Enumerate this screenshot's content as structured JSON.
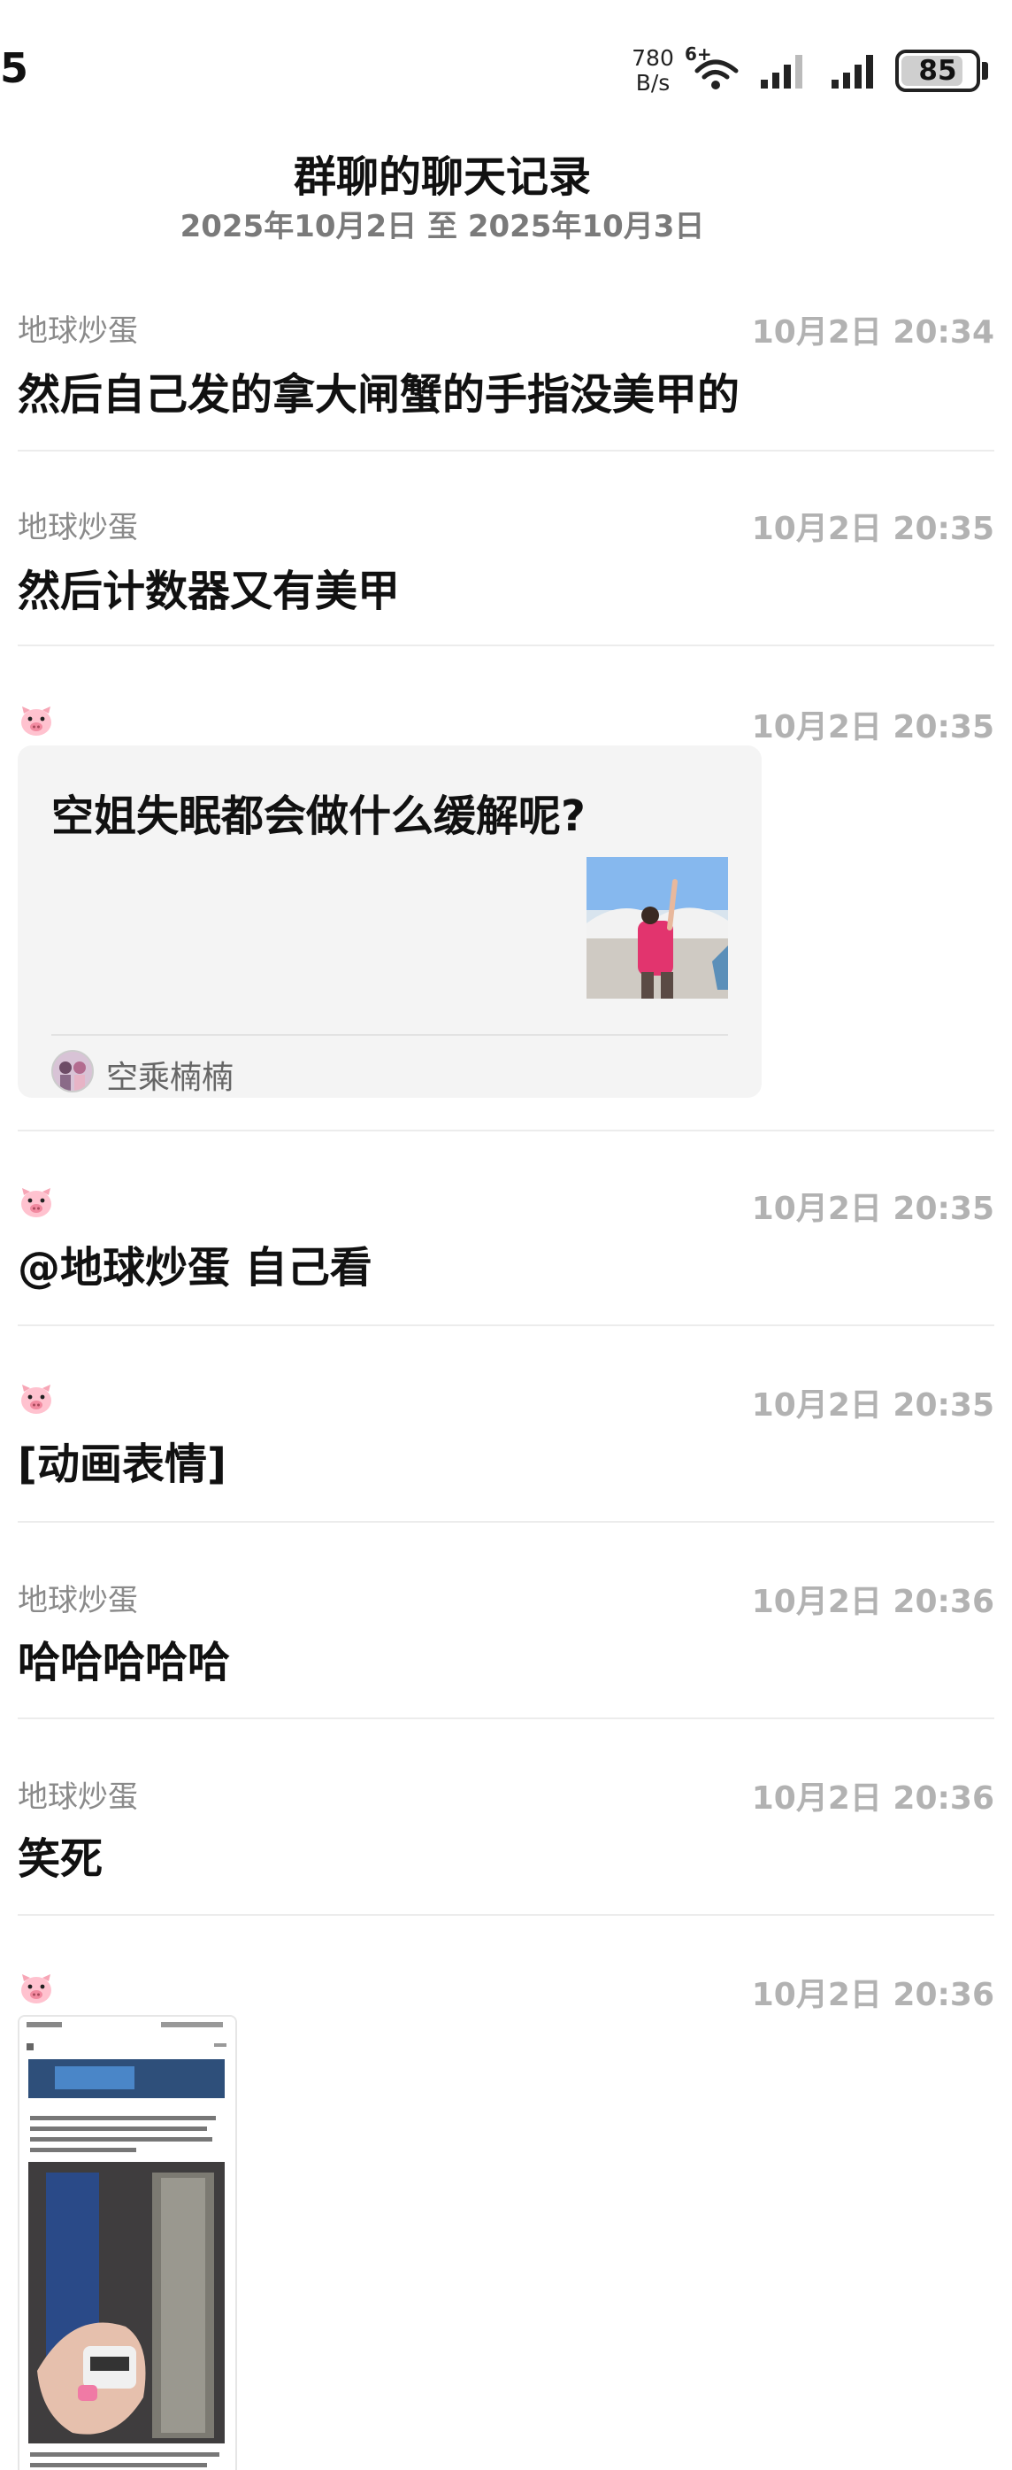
{
  "status_bar": {
    "time": "5",
    "net_speed_value": "780",
    "net_speed_unit": "B/s",
    "wifi_badge": "6+",
    "battery_level": 85,
    "battery_text": "85",
    "icons": [
      "wifi-icon",
      "signal-icon",
      "signal-icon",
      "battery-icon"
    ]
  },
  "header": {
    "title": "群聊的聊天记录",
    "date_range": "2025年10月2日 至 2025年10月3日"
  },
  "messages": [
    {
      "sender": "地球炒蛋",
      "time": "10月2日 20:34",
      "text": "然后自己发的拿大闸蟹的手指没美甲的"
    },
    {
      "sender": "地球炒蛋",
      "time": "10月2日 20:35",
      "text": "然后计数器又有美甲"
    },
    {
      "sender_icon": "pig-emoji-icon",
      "time": "10月2日 20:35",
      "card": {
        "title": "空姐失眠都会做什么缓解呢?",
        "author": "空乘楠楠"
      }
    },
    {
      "sender_icon": "pig-emoji-icon",
      "time": "10月2日 20:35",
      "text": "@地球炒蛋 自己看"
    },
    {
      "sender_icon": "pig-emoji-icon",
      "time": "10月2日 20:35",
      "text": "[动画表情]"
    },
    {
      "sender": "地球炒蛋",
      "time": "10月2日 20:36",
      "text": "哈哈哈哈哈"
    },
    {
      "sender": "地球炒蛋",
      "time": "10月2日 20:36",
      "text": "笑死"
    },
    {
      "sender_icon": "pig-emoji-icon",
      "time": "10月2日 20:36",
      "image": "screenshot-thumbnail"
    }
  ],
  "colors": {
    "sender": "#8a8a8a",
    "time": "#b2b2b2",
    "text": "#111111",
    "divider": "#ececec",
    "card_bg": "#f4f4f4"
  }
}
